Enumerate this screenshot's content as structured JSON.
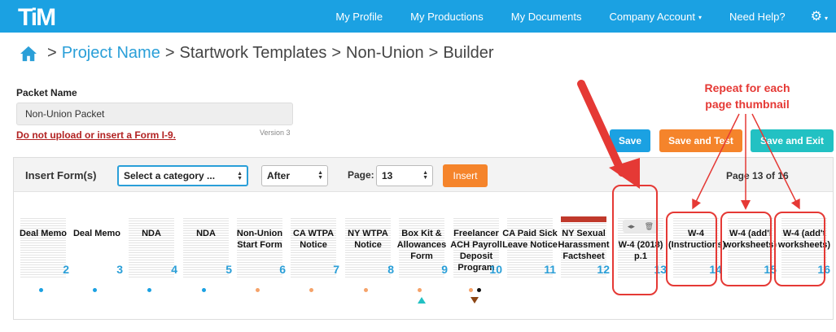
{
  "nav": {
    "logo": "TiM",
    "items": [
      "My Profile",
      "My Productions",
      "My Documents",
      "Company Account",
      "Need Help?"
    ],
    "caret": "▾",
    "settings_icon": "⚙"
  },
  "breadcrumb": {
    "home_icon": "home-icon",
    "separator": ">",
    "project": "Project Name",
    "startwork": "Startwork Templates",
    "nonunion": "Non-Union",
    "builder": "Builder"
  },
  "packet": {
    "label": "Packet Name",
    "value": "Non-Union Packet",
    "warning": "Do not upload or insert a Form I-9.",
    "version": "Version 3"
  },
  "actions": {
    "save": "Save",
    "save_test": "Save and Test",
    "save_exit": "Save and Exit"
  },
  "insert": {
    "label": "Insert Form(s)",
    "category": "Select a category ...",
    "position": "After",
    "page_label": "Page:",
    "page_value": "13",
    "insert_btn": "Insert",
    "page_of": "Page 13 of 16"
  },
  "thumbnails": [
    {
      "title": "Deal Memo",
      "num": "2",
      "dot": "blue"
    },
    {
      "title": "Deal Memo",
      "num": "3",
      "dot": "blue"
    },
    {
      "title": "NDA",
      "num": "4",
      "dot": "blue"
    },
    {
      "title": "NDA",
      "num": "5",
      "dot": "blue"
    },
    {
      "title": "Non-Union Start Form",
      "num": "6",
      "dot": "orange"
    },
    {
      "title": "CA WTPA Notice",
      "num": "7",
      "dot": "orange"
    },
    {
      "title": "NY WTPA Notice",
      "num": "8",
      "dot": "orange"
    },
    {
      "title": "Box Kit & Allowances Form",
      "num": "9",
      "dot": "orange"
    },
    {
      "title": "Freelancer ACH Payroll Deposit Program",
      "num": "10",
      "dot": "orange"
    },
    {
      "title": "CA Paid Sick Leave Notice",
      "num": "11",
      "dot": "orange"
    },
    {
      "title": "NY Sexual Harassment Factsheet",
      "num": "12",
      "dot": ""
    },
    {
      "title": "W-4 (2018) p.1",
      "num": "13",
      "dot": ""
    },
    {
      "title": "W-4 (Instructions)",
      "num": "14",
      "dot": ""
    },
    {
      "title": "W-4 (add'l worksheets)",
      "num": "15",
      "dot": ""
    },
    {
      "title": "W-4 (add't worksheets)",
      "num": "16",
      "dot": ""
    }
  ],
  "annotation": {
    "line1": "Repeat for each",
    "line2": "page thumbnail",
    "color": "#e53935"
  },
  "colors": {
    "nav": "#1ba1e2",
    "link": "#2a9fd8",
    "orange": "#f5842b",
    "teal": "#22c1c3",
    "warning": "#b22222"
  }
}
